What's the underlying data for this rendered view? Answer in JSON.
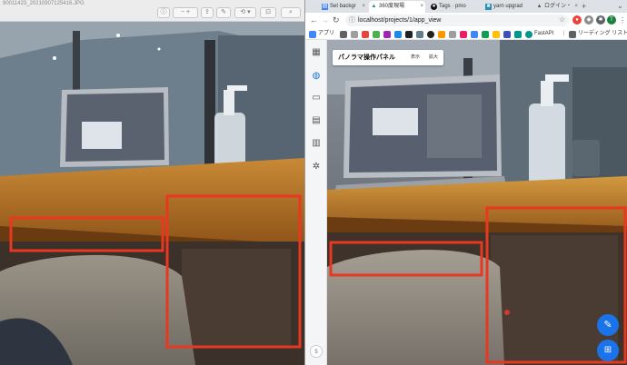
{
  "viewer": {
    "filename": "90011423_20210907125416.JPG"
  },
  "browser": {
    "tabs": [
      {
        "label": "Set backgr",
        "icon": "doc-icon"
      },
      {
        "label": "360度現場",
        "icon": "drive-triangle-icon",
        "active": true
      },
      {
        "label": "Tags · pmo",
        "icon": "github-icon"
      },
      {
        "label": "yarn upgrad",
        "icon": "box-icon"
      },
      {
        "label": "ログイン・",
        "icon": "drive-triangle-icon"
      }
    ],
    "new_tab": "+",
    "url": "localhost/projects/1/app_view",
    "profile_initial": "T",
    "bookmarks": {
      "apps_label": "アプリ",
      "fastapi_label": "FastAPI",
      "reading_list_label": "リーディング リスト"
    }
  },
  "app": {
    "panel": {
      "title": "パノラマ操作パネル",
      "show_label": "表示",
      "zoom_label": "拡大"
    },
    "sidebar_badge": "5",
    "sidebar_icons": [
      "dashboard-icon",
      "globe-icon",
      "chat-icon",
      "document-icon",
      "map-icon",
      "settings-icon"
    ]
  },
  "colors": {
    "annotation_red": "#e8381f",
    "fab_blue": "#1a73e8",
    "active_sidebar": "#1976d2"
  }
}
